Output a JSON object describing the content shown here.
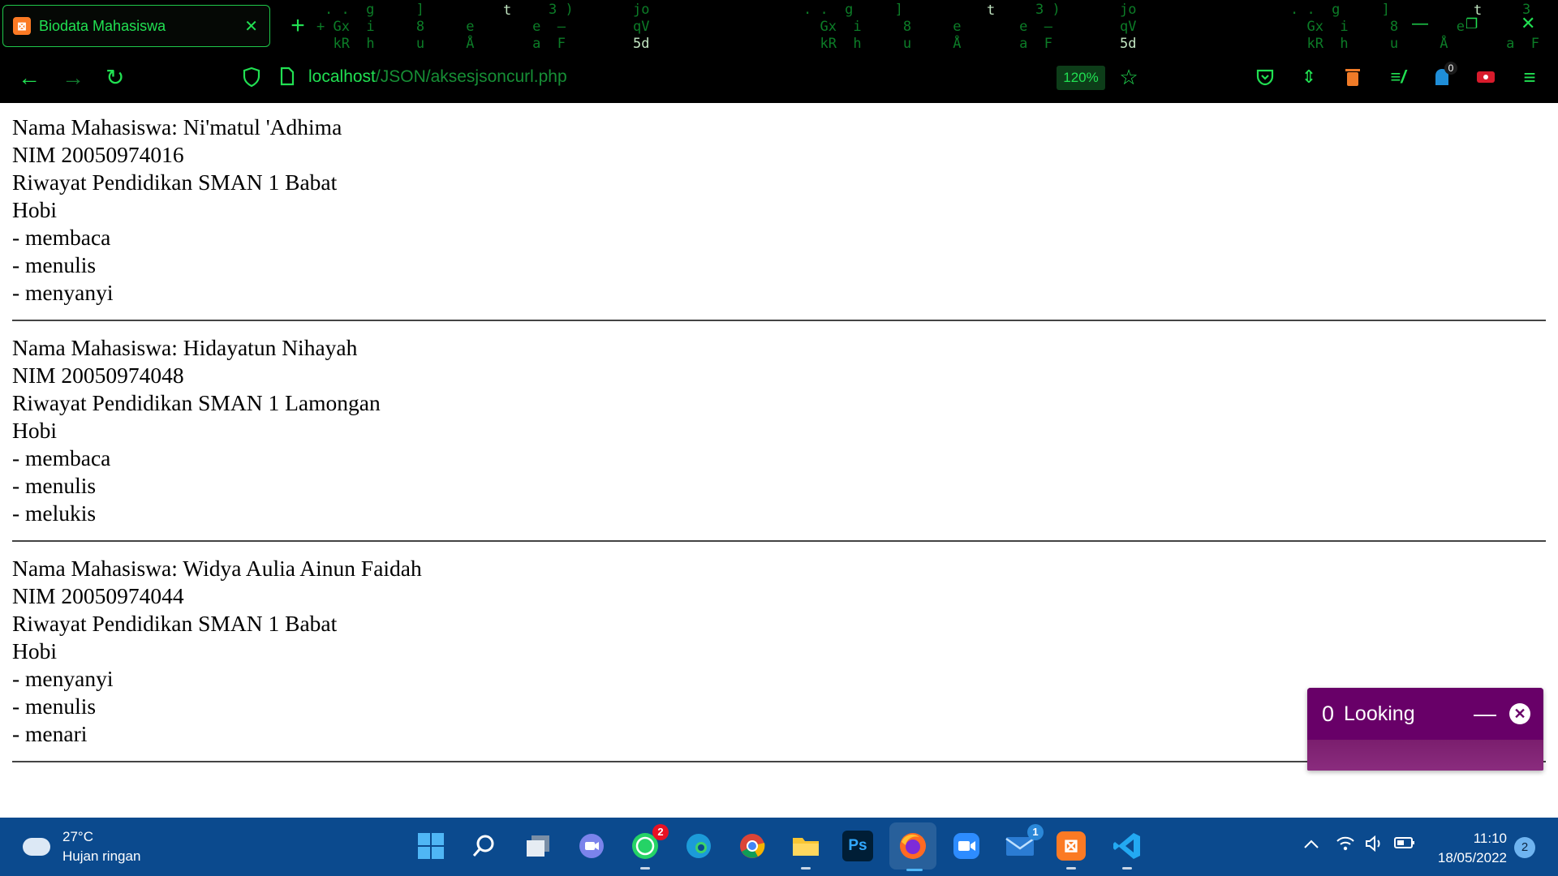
{
  "browser": {
    "tab_title": "Biodata Mahasiswa",
    "tab_close": "✕",
    "new_tab": "+",
    "url_host": "localhost",
    "url_path": "/JSON/aksesjsoncurl.php",
    "zoom": "120%",
    "extension_badge": "0"
  },
  "students": [
    {
      "name": "Nama Mahasiswa: Ni'matul 'Adhima",
      "nim": "NIM 20050974016",
      "education": "Riwayat Pendidikan SMAN 1 Babat",
      "hobby_label": "Hobi",
      "hobbies": [
        "- membaca",
        "- menulis",
        "- menyanyi"
      ]
    },
    {
      "name": "Nama Mahasiswa: Hidayatun Nihayah",
      "nim": "NIM 20050974048",
      "education": "Riwayat Pendidikan SMAN 1 Lamongan",
      "hobby_label": "Hobi",
      "hobbies": [
        "- membaca",
        "- menulis",
        "- melukis"
      ]
    },
    {
      "name": "Nama Mahasiswa: Widya Aulia Ainun Faidah",
      "nim": "NIM 20050974044",
      "education": "Riwayat Pendidikan SMAN 1 Babat",
      "hobby_label": "Hobi",
      "hobbies": [
        "- menyanyi",
        "- menulis",
        "- menari"
      ]
    }
  ],
  "looking_popup": {
    "count": "0",
    "label": "Looking",
    "minimize": "—",
    "close": "✕"
  },
  "taskbar": {
    "temperature": "27°C",
    "weather": "Hujan ringan",
    "whatsapp_badge": "2",
    "mail_badge": "1",
    "time": "11:10",
    "date": "18/05/2022",
    "notification_count": "2"
  },
  "colors": {
    "theme_green": "#21e052",
    "taskbar_blue": "#0b4a8e",
    "popup_purple": "#680068"
  }
}
